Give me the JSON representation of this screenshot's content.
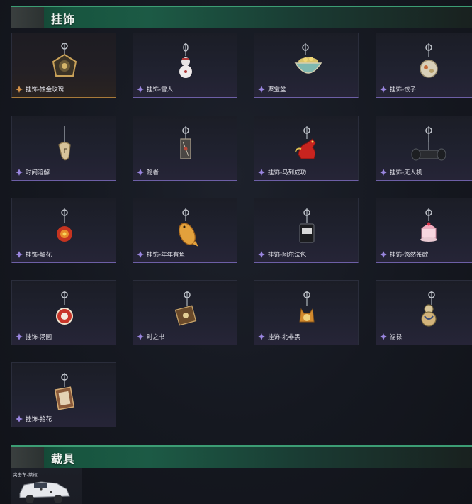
{
  "sections": {
    "charms": {
      "title": "挂饰"
    },
    "vehicles": {
      "title": "载具",
      "vehicle_tag": "突击车-茶枢"
    }
  },
  "colors": {
    "header_green": "#17553f",
    "rare_purple": "#6d5fa6",
    "legendary_gold": "#a87a3a"
  },
  "items": [
    {
      "label": "挂饰-蚀金玫瑰",
      "rarity": "legendary",
      "icon": "rose-medallion-charm-icon"
    },
    {
      "label": "挂饰-雪人",
      "rarity": "rare",
      "icon": "snowman-charm-icon"
    },
    {
      "label": "聚宝盆",
      "rarity": "rare",
      "icon": "treasure-bowl-charm-icon"
    },
    {
      "label": "挂饰-饺子",
      "rarity": "rare",
      "icon": "dumpling-charm-icon"
    },
    {
      "label": "时间溶解",
      "rarity": "rare",
      "icon": "melting-clock-charm-icon"
    },
    {
      "label": "隐者",
      "rarity": "rare",
      "icon": "hermit-card-charm-icon"
    },
    {
      "label": "挂饰-马到成功",
      "rarity": "rare",
      "icon": "red-horse-charm-icon"
    },
    {
      "label": "挂饰-无人机",
      "rarity": "rare",
      "icon": "drone-charm-icon"
    },
    {
      "label": "挂饰-鲷花",
      "rarity": "rare",
      "icon": "fire-flower-charm-icon"
    },
    {
      "label": "挂饰-年年有鱼",
      "rarity": "rare",
      "icon": "fish-charm-icon"
    },
    {
      "label": "挂饰-阿尔法包",
      "rarity": "rare",
      "icon": "alpha-bag-charm-icon"
    },
    {
      "label": "挂饰-悠然茶歇",
      "rarity": "rare",
      "icon": "tea-cup-charm-icon"
    },
    {
      "label": "挂饰-汤圆",
      "rarity": "rare",
      "icon": "rice-ball-charm-icon"
    },
    {
      "label": "时之书",
      "rarity": "rare",
      "icon": "book-of-time-charm-icon"
    },
    {
      "label": "挂饰-北非黑",
      "rarity": "rare",
      "icon": "black-cat-charm-icon"
    },
    {
      "label": "福禄",
      "rarity": "rare",
      "icon": "gourd-charm-icon"
    },
    {
      "label": "挂饰-拾花",
      "rarity": "rare",
      "icon": "flower-frame-charm-icon"
    }
  ]
}
